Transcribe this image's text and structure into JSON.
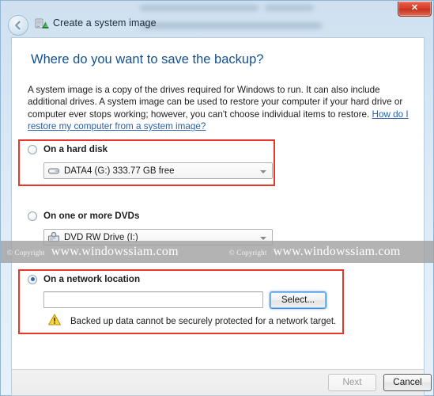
{
  "window": {
    "title": "Create a system image",
    "close_label": "✕",
    "back_icon": "back-arrow-icon",
    "app_icon": "system-image-icon"
  },
  "content": {
    "heading": "Where do you want to save the backup?",
    "description_part1": "A system image is a copy of the drives required for Windows to run. It can also include additional drives. A system image can be used to restore your computer if your hard drive or computer ever stops working; however, you can't choose individual items to restore. ",
    "help_link": "How do I restore my computer from a system image?"
  },
  "options": {
    "hard_disk": {
      "label": "On a hard disk",
      "selected": false,
      "combo_value": "DATA4 (G:)  333.77 GB free",
      "combo_icon": "hard-disk-icon"
    },
    "dvd": {
      "label": "On one or more DVDs",
      "selected": false,
      "combo_value": "DVD RW Drive (I:)",
      "combo_icon": "dvd-drive-icon"
    },
    "network": {
      "label": "On a network location",
      "selected": true,
      "path_value": "",
      "path_placeholder": "",
      "select_button": "Select...",
      "warning_icon": "warning-triangle-icon",
      "warning_text": "Backed up data cannot be securely protected for a network target."
    }
  },
  "footer": {
    "next_label": "Next",
    "next_disabled": true,
    "cancel_label": "Cancel"
  },
  "watermark": {
    "copyright": "© Copyright",
    "site": "www.windowssiam.com"
  },
  "colors": {
    "heading": "#14508f",
    "link": "#2a5fa8",
    "annotation_red": "#e8362a",
    "close_red": "#d93b26",
    "warning_yellow": "#f5c518",
    "focus_blue": "#3c8edb"
  }
}
